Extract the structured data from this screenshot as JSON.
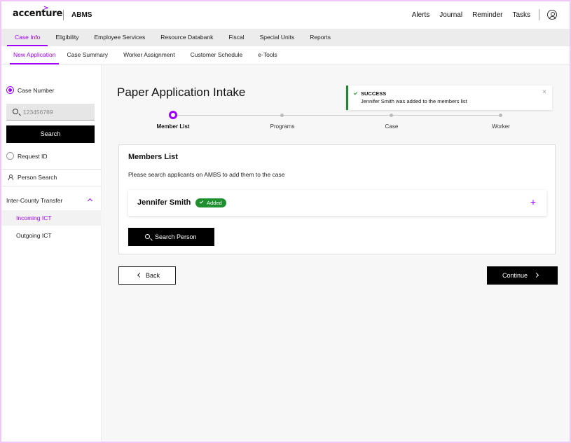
{
  "header": {
    "logo_text": "accenture",
    "app_name": "ABMS",
    "nav": [
      "Alerts",
      "Journal",
      "Reminder",
      "Tasks"
    ],
    "user_icon": "user-circle-icon"
  },
  "primary_tabs": [
    "Case Info",
    "Eligibility",
    "Employee Services",
    "Resource Databank",
    "Fiscal",
    "Special Units",
    "Reports"
  ],
  "secondary_tabs": [
    "New Application",
    "Case Summary",
    "Worker Assignment",
    "Customer Schedule",
    "e-Tools"
  ],
  "sidebar": {
    "case_number_label": "Case Number",
    "search_placeholder": "123456789",
    "search_button": "Search",
    "request_id_label": "Request ID",
    "person_search_label": "Person Search",
    "group_label": "Inter-County Transfer",
    "group_items": [
      "Incoming ICT",
      "Outgoing ICT"
    ]
  },
  "main": {
    "page_title": "Paper Application Intake",
    "toast": {
      "title": "SUCCESS",
      "message": "Jennifer Smith was added to the members list",
      "close": "×"
    },
    "steps": [
      "Member List",
      "Programs",
      "Case",
      "Worker"
    ],
    "card": {
      "title": "Members List",
      "subtitle": "Please search applicants on AMBS to add them to the case",
      "member_name": "Jennifer Smith",
      "member_badge": "Added",
      "add_icon": "+",
      "search_button": "Search Person"
    },
    "back_button": "Back",
    "continue_button": "Continue"
  },
  "colors": {
    "accent": "#a100ff",
    "success": "#1e8f2e"
  }
}
